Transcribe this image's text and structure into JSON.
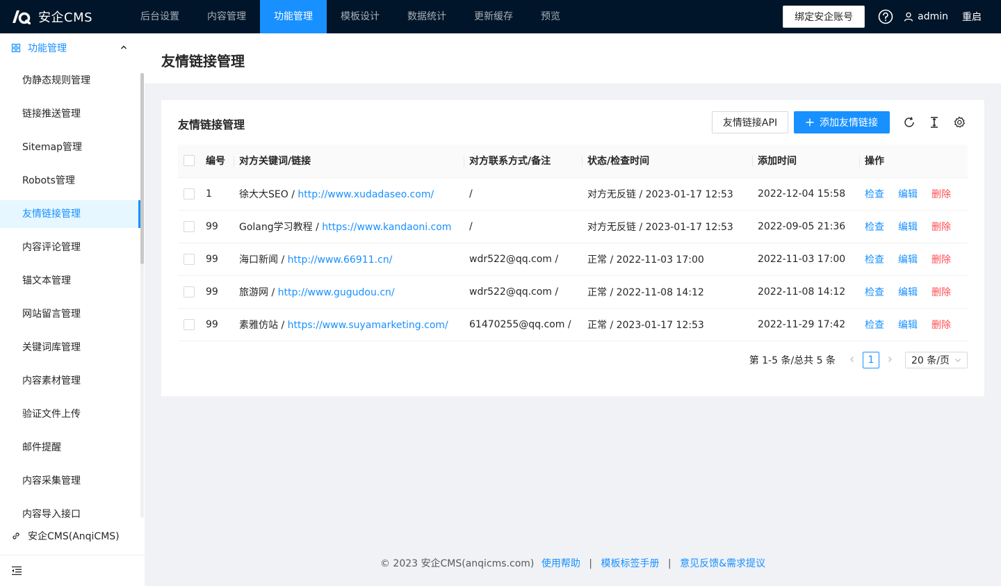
{
  "brand": {
    "name": "安企CMS"
  },
  "nav": {
    "items": [
      {
        "label": "后台设置"
      },
      {
        "label": "内容管理"
      },
      {
        "label": "功能管理"
      },
      {
        "label": "模板设计"
      },
      {
        "label": "数据统计"
      },
      {
        "label": "更新缓存"
      },
      {
        "label": "预览"
      }
    ],
    "active": "功能管理"
  },
  "topbar": {
    "bind_label": "绑定安企账号",
    "help_icon": "question-circle-icon",
    "user": "admin",
    "restart_label": "重启"
  },
  "sidebar": {
    "group_label": "功能管理",
    "items": [
      {
        "label": "伪静态规则管理"
      },
      {
        "label": "链接推送管理"
      },
      {
        "label": "Sitemap管理"
      },
      {
        "label": "Robots管理"
      },
      {
        "label": "友情链接管理"
      },
      {
        "label": "内容评论管理"
      },
      {
        "label": "锚文本管理"
      },
      {
        "label": "网站留言管理"
      },
      {
        "label": "关键词库管理"
      },
      {
        "label": "内容素材管理"
      },
      {
        "label": "验证文件上传"
      },
      {
        "label": "邮件提醒"
      },
      {
        "label": "内容采集管理"
      },
      {
        "label": "内容导入接口"
      }
    ],
    "active_item": "友情链接管理",
    "footer_link": "安企CMS(AnqiCMS)"
  },
  "page": {
    "title": "友情链接管理"
  },
  "card": {
    "title": "友情链接管理",
    "api_label": "友情链接API",
    "add_label": "添加友情链接",
    "tool_icons": [
      "reload-icon",
      "column-height-icon",
      "setting-icon"
    ]
  },
  "table": {
    "headers": {
      "id": "编号",
      "keyword": "对方关键词/链接",
      "contact": "对方联系方式/备注",
      "status": "状态/检查时间",
      "created": "添加时间",
      "ops": "操作"
    },
    "ops": {
      "check": "检查",
      "edit": "编辑",
      "delete": "删除"
    },
    "rows": [
      {
        "id": "1",
        "name": "徐大大SEO",
        "url": "http://www.xudadaseo.com/",
        "contact": "/",
        "status": "对方无反链 / 2023-01-17 12:53",
        "created": "2022-12-04 15:58"
      },
      {
        "id": "99",
        "name": "Golang学习教程",
        "url": "https://www.kandaoni.com",
        "contact": "/",
        "status": "对方无反链 / 2023-01-17 12:53",
        "created": "2022-09-05 21:36"
      },
      {
        "id": "99",
        "name": "海口新闻",
        "url": "http://www.66911.cn/",
        "contact": "wdr522@qq.com /",
        "status": "正常 / 2022-11-03 17:00",
        "created": "2022-11-03 17:00"
      },
      {
        "id": "99",
        "name": "旅游网",
        "url": "http://www.gugudou.cn/",
        "contact": "wdr522@qq.com /",
        "status": "正常 / 2022-11-08 14:12",
        "created": "2022-11-08 14:12"
      },
      {
        "id": "99",
        "name": "素雅仿站",
        "url": "https://www.suyamarketing.com/",
        "contact": "61470255@qq.com /",
        "status": "正常 / 2023-01-17 12:53",
        "created": "2022-11-29 17:42"
      }
    ]
  },
  "pagination": {
    "total_text": "第 1-5 条/总共 5 条",
    "current_page": "1",
    "page_size": "20 条/页"
  },
  "footer": {
    "copyright": "© 2023 安企CMS(anqicms.com)",
    "links": [
      {
        "label": "使用帮助"
      },
      {
        "label": "模板标签手册"
      },
      {
        "label": "意见反馈&需求提议"
      }
    ],
    "separator": "|"
  },
  "colors": {
    "primary": "#1890ff",
    "topbar_bg": "#001529",
    "danger": "#ff4d4f",
    "page_bg": "#f0f2f5"
  }
}
